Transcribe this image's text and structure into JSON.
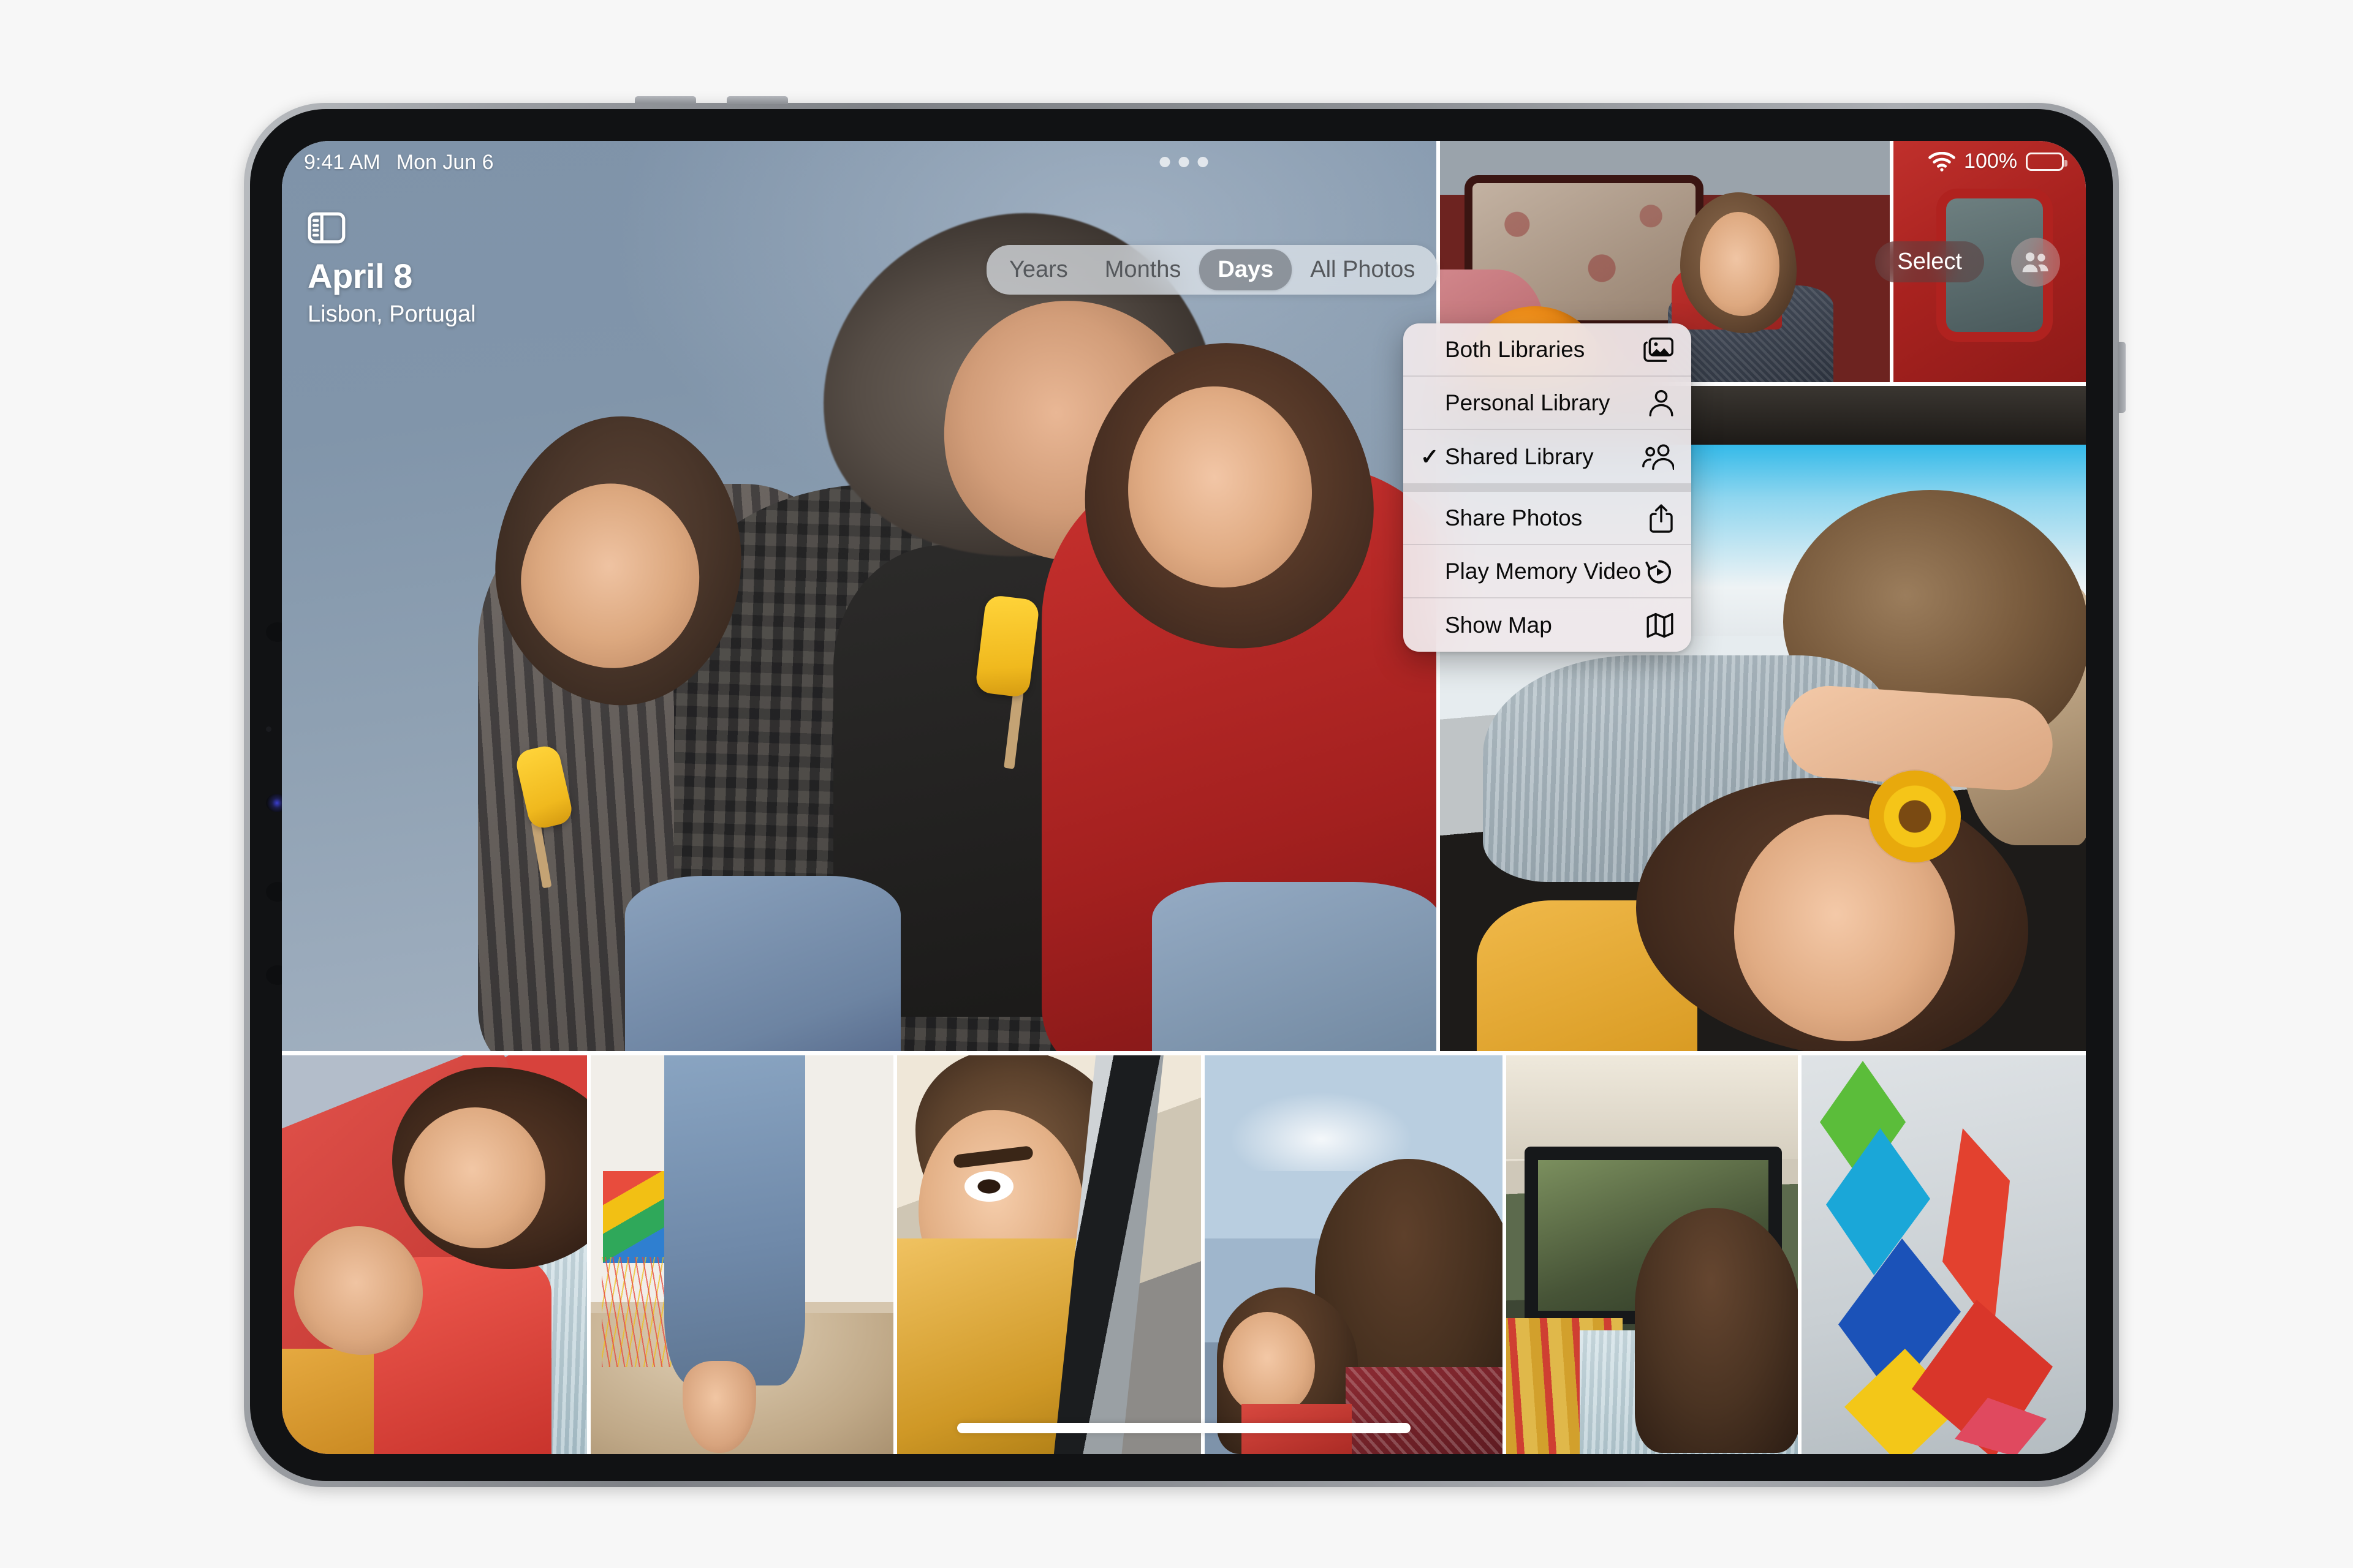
{
  "status_bar": {
    "time": "9:41 AM",
    "date": "Mon Jun 6",
    "battery_percent": "100%",
    "wifi_icon": "wifi-icon",
    "battery_icon": "battery-icon"
  },
  "nav": {
    "sidebar_toggle_icon": "sidebar-toggle-icon",
    "title": "April 8",
    "subtitle": "Lisbon, Portugal",
    "select_label": "Select",
    "avatar_icon": "shared-library-people-icon",
    "multitask_icon": "multitask-dots-icon"
  },
  "segmented_control": {
    "selected": "Days",
    "options": [
      {
        "label": "Years",
        "selected": false
      },
      {
        "label": "Months",
        "selected": false
      },
      {
        "label": "Days",
        "selected": true
      },
      {
        "label": "All Photos",
        "selected": false
      }
    ]
  },
  "context_menu": {
    "groups": [
      {
        "items": [
          {
            "label": "Both Libraries",
            "icon": "photo-stack-icon",
            "checked": false
          },
          {
            "label": "Personal Library",
            "icon": "person-icon",
            "checked": false
          },
          {
            "label": "Shared Library",
            "icon": "two-people-icon",
            "checked": true
          }
        ]
      },
      {
        "items": [
          {
            "label": "Share Photos",
            "icon": "share-icon",
            "checked": false
          },
          {
            "label": "Play Memory Video",
            "icon": "play-memory-icon",
            "checked": false
          },
          {
            "label": "Show Map",
            "icon": "map-icon",
            "checked": false
          }
        ]
      }
    ]
  },
  "photo_grid": {
    "hero": {
      "name": "photo-father-with-daughters-popsicles"
    },
    "right_column": [
      {
        "name": "photo-girl-with-ball-by-van"
      },
      {
        "name": "photo-red-van-window"
      },
      {
        "name": "photo-girls-with-flower-and-dog"
      }
    ],
    "bottom_row": [
      {
        "name": "photo-two-girls-lying-on-red"
      },
      {
        "name": "photo-kite-on-beach"
      },
      {
        "name": "photo-girl-looking-out-window"
      },
      {
        "name": "photo-two-girls-sky"
      },
      {
        "name": "photo-girl-in-van-window"
      },
      {
        "name": "photo-colorful-kites"
      }
    ]
  },
  "home_indicator": {
    "name": "home-indicator"
  },
  "colors": {
    "accent_red": "#c0302c",
    "sky_blue_grey": "#8195aa",
    "menu_bg": "#eee8ea",
    "selected_segment": "#7a8088"
  }
}
